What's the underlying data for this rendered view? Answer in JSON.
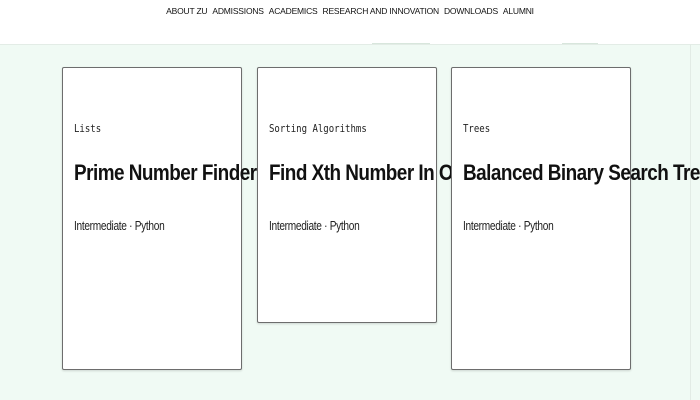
{
  "nav": {
    "items": [
      "ABOUT ZU",
      "ADMISSIONS",
      "ACADEMICS",
      "RESEARCH AND INNOVATION",
      "DOWNLOADS",
      "ALUMNI"
    ]
  },
  "cards": [
    {
      "category": "Lists",
      "title": "Prime Number Finder",
      "meta": "Intermediate · Python"
    },
    {
      "category": "Sorting Algorithms",
      "title": "Find Xth Number In Order",
      "meta": "Intermediate · Python"
    },
    {
      "category": "Trees",
      "title": "Balanced Binary Search Tree",
      "meta": "Intermediate · Python"
    }
  ],
  "colors": {
    "page_background": "#f0faf4",
    "header_background": "#ffffff",
    "card_background": "#ffffff",
    "card_border": "#6d6d6d"
  }
}
